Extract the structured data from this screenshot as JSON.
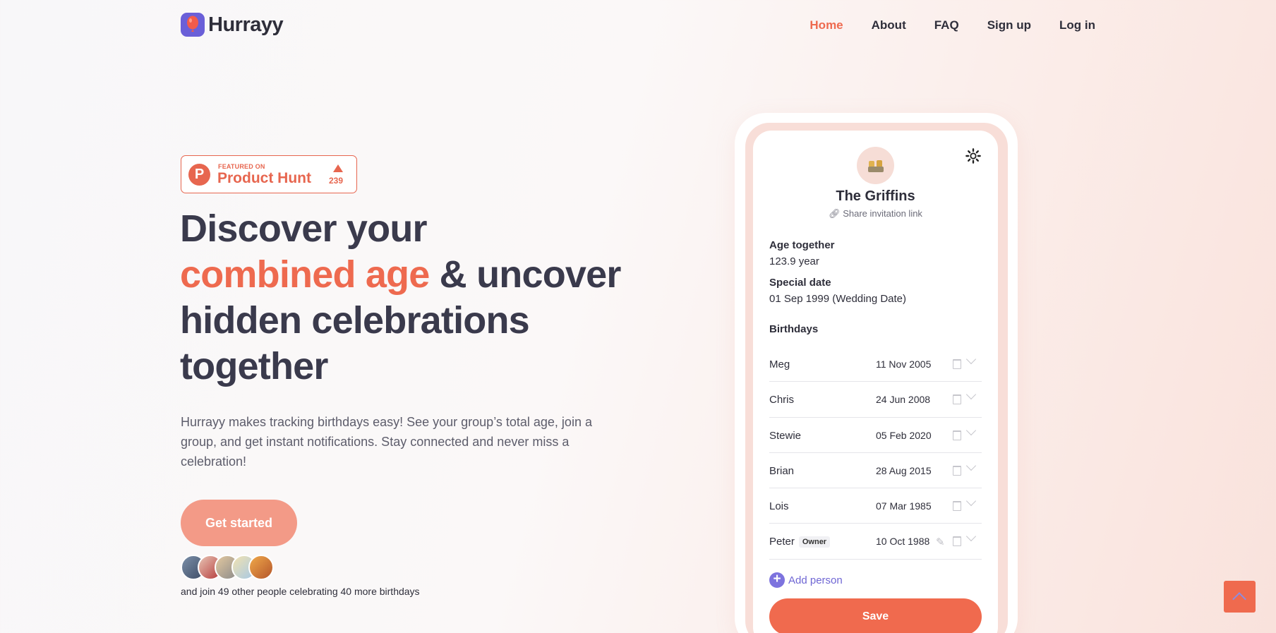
{
  "brand": {
    "name": "Hurrayy"
  },
  "nav": {
    "items": [
      {
        "label": "Home",
        "active": true
      },
      {
        "label": "About"
      },
      {
        "label": "FAQ"
      },
      {
        "label": "Sign up"
      },
      {
        "label": "Log in"
      }
    ]
  },
  "product_hunt": {
    "featured": "FEATURED ON",
    "name": "Product Hunt",
    "count": "239"
  },
  "hero": {
    "line1": "Discover your",
    "accent": "combined age",
    "line2_rest": " & uncover",
    "line3": "hidden celebrations",
    "line4": "together",
    "description": "Hurrayy makes tracking birthdays easy! See your group’s total age, join a group, and get instant notifications. Stay connected and never miss a celebration!",
    "cta": "Get started",
    "join_text": "and join 49 other people celebrating 40 more birthdays"
  },
  "app": {
    "group_name": "The Griffins",
    "share_link": "Share invitation link",
    "age_label": "Age together",
    "age_value": "123.9 year",
    "special_label": "Special date",
    "special_value": "01 Sep 1999 (Wedding Date)",
    "birthdays_label": "Birthdays",
    "people": [
      {
        "name": "Meg",
        "date": "11 Nov 2005"
      },
      {
        "name": "Chris",
        "date": "24 Jun 2008"
      },
      {
        "name": "Stewie",
        "date": "05 Feb 2020"
      },
      {
        "name": "Brian",
        "date": "28 Aug 2015"
      },
      {
        "name": "Lois",
        "date": "07 Mar 1985"
      },
      {
        "name": "Peter",
        "badge": "Owner",
        "date": "10 Oct 1988"
      }
    ],
    "add_person": "Add person",
    "save": "Save"
  },
  "colors": {
    "accent": "#ee6a4f",
    "brand_purple": "#6a5fd8",
    "cta_light": "#f39a87"
  },
  "icons": [
    "balloon-logo-icon",
    "product-hunt-logo-icon",
    "upvote-arrow-icon",
    "gear-icon",
    "link-icon",
    "pencil-icon",
    "trash-icon",
    "chevron-down-icon",
    "plus-circle-icon",
    "chevron-up-icon"
  ]
}
